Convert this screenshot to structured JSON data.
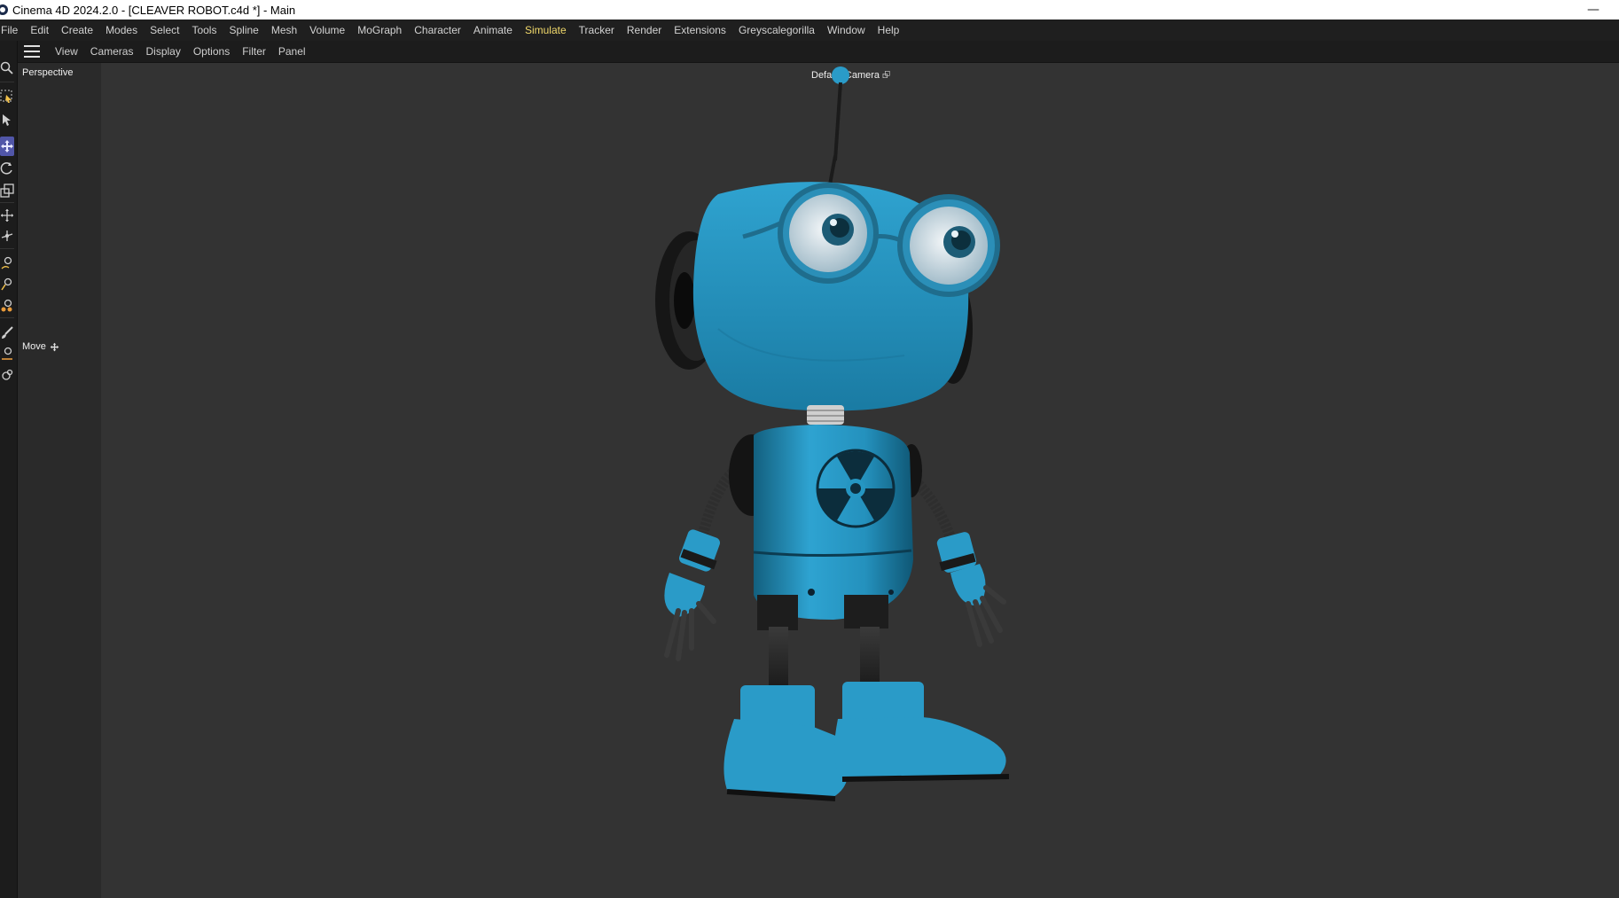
{
  "window": {
    "title": "Cinema 4D 2024.2.0 - [CLEAVER ROBOT.c4d *] - Main",
    "minimize_glyph": "—"
  },
  "menubar": {
    "items": [
      "File",
      "Edit",
      "Create",
      "Modes",
      "Select",
      "Tools",
      "Spline",
      "Mesh",
      "Volume",
      "MoGraph",
      "Character",
      "Animate",
      "Simulate",
      "Tracker",
      "Render",
      "Extensions",
      "Greyscalegorilla",
      "Window",
      "Help"
    ],
    "active": "Simulate"
  },
  "viewbar": {
    "items": [
      "View",
      "Cameras",
      "Display",
      "Options",
      "Filter",
      "Panel"
    ]
  },
  "viewport": {
    "projection": "Perspective",
    "camera": "Default Camera",
    "active_tool": "Move"
  },
  "toolbar": {
    "tools": [
      "zoom-icon",
      "live-selection-icon",
      "select-cursor-icon",
      "move-tool-icon",
      "rotate-tool-icon",
      "scale-tool-icon",
      "transform-icon",
      "axis-icon",
      "sculpt-pen-icon",
      "sculpt-brush-icon",
      "sculpt-pull-icon",
      "paint-brush-icon",
      "knife-icon",
      "weld-icon"
    ],
    "selected": "move-tool-icon"
  },
  "colors": {
    "accent_menu": "#f1d96b",
    "selected_tool": "#5156a8",
    "robot_blue": "#2b9ac7",
    "viewport_bg": "#333333"
  }
}
